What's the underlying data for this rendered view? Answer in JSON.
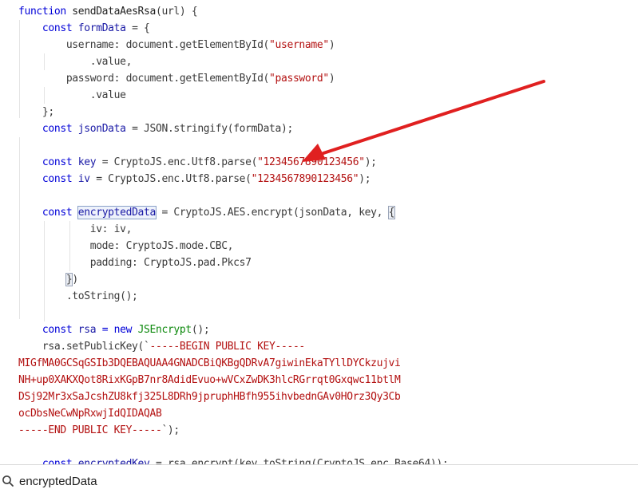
{
  "editor": {
    "lines": [
      [
        {
          "t": "function ",
          "c": "kw"
        },
        {
          "t": "sendDataAesRsa",
          "c": "fn"
        },
        {
          "t": "(url) {",
          "c": "id"
        }
      ],
      [
        {
          "t": "    const ",
          "c": "kw"
        },
        {
          "t": "formData",
          "c": "var"
        },
        {
          "t": " = {",
          "c": "id"
        }
      ],
      [
        {
          "t": "        username: document.getElementById(",
          "c": "id"
        },
        {
          "t": "\"username\"",
          "c": "str"
        },
        {
          "t": ")",
          "c": "id"
        }
      ],
      [
        {
          "t": "            .value,",
          "c": "id"
        }
      ],
      [
        {
          "t": "        password: document.getElementById(",
          "c": "id"
        },
        {
          "t": "\"password\"",
          "c": "str"
        },
        {
          "t": ")",
          "c": "id"
        }
      ],
      [
        {
          "t": "            .value",
          "c": "id"
        }
      ],
      [
        {
          "t": "    };",
          "c": "id"
        }
      ],
      [
        {
          "t": "    const ",
          "c": "kw"
        },
        {
          "t": "jsonData",
          "c": "var"
        },
        {
          "t": " = JSON.stringify(formData);",
          "c": "id"
        }
      ],
      [],
      [
        {
          "t": "    const ",
          "c": "kw"
        },
        {
          "t": "key",
          "c": "var"
        },
        {
          "t": " = CryptoJS.enc.Utf8.parse(",
          "c": "id"
        },
        {
          "t": "\"1234567890123456\"",
          "c": "str"
        },
        {
          "t": ");",
          "c": "id"
        }
      ],
      [
        {
          "t": "    const ",
          "c": "kw"
        },
        {
          "t": "iv",
          "c": "var"
        },
        {
          "t": " = CryptoJS.enc.Utf8.parse(",
          "c": "id"
        },
        {
          "t": "\"1234567890123456\"",
          "c": "str"
        },
        {
          "t": ");",
          "c": "id"
        }
      ],
      [],
      [
        {
          "t": "    const ",
          "c": "kw"
        },
        {
          "t": "encryptedData",
          "c": "var",
          "m": "bound"
        },
        {
          "t": " = CryptoJS.AES.encrypt(jsonData, key, ",
          "c": "id"
        },
        {
          "t": "{",
          "c": "id",
          "m": "brk"
        }
      ],
      [
        {
          "t": "            iv: iv,",
          "c": "id"
        }
      ],
      [
        {
          "t": "            mode: CryptoJS.mode.CBC,",
          "c": "id"
        }
      ],
      [
        {
          "t": "            padding: CryptoJS.pad.Pkcs7",
          "c": "id"
        }
      ],
      [
        {
          "t": "        ",
          "c": "id"
        },
        {
          "t": "}",
          "c": "id",
          "m": "brk"
        },
        {
          "t": ")",
          "c": "id"
        }
      ],
      [
        {
          "t": "        .toString();",
          "c": "id"
        }
      ],
      [],
      [
        {
          "t": "    const ",
          "c": "kw"
        },
        {
          "t": "rsa",
          "c": "var"
        },
        {
          "t": " = new ",
          "c": "kw"
        },
        {
          "t": "JSEncrypt",
          "c": "cls"
        },
        {
          "t": "();",
          "c": "id"
        }
      ],
      [
        {
          "t": "    rsa.setPublicKey(`",
          "c": "id"
        },
        {
          "t": "-----BEGIN PUBLIC KEY-----",
          "c": "str"
        }
      ],
      [
        {
          "t": "MIGfMA0GCSqGSIb3DQEBAQUAA4GNADCBiQKBgQDRvA7giwinEkaTYllDYCkzujvi",
          "c": "str"
        }
      ],
      [
        {
          "t": "NH+up0XAKXQot8RixKGpB7nr8AdidEvuo+wVCxZwDK3hlcRGrrqt0Gxqwc11btlM",
          "c": "str"
        }
      ],
      [
        {
          "t": "DSj92Mr3xSaJcshZU8kfj325L8DRh9jpruphHBfh955ihvbednGAv0HOrz3Qy3Cb",
          "c": "str"
        }
      ],
      [
        {
          "t": "ocDbsNeCwNpRxwjIdQIDAQAB",
          "c": "str"
        }
      ],
      [
        {
          "t": "-----END PUBLIC KEY-----",
          "c": "str"
        },
        {
          "t": "`);",
          "c": "id"
        }
      ],
      [],
      [
        {
          "t": "    const ",
          "c": "kw"
        },
        {
          "t": "encryptedKey",
          "c": "var"
        },
        {
          "t": " = rsa.encrypt(key.toString(CryptoJS.enc.Base64));",
          "c": "id"
        }
      ]
    ]
  },
  "search": {
    "icon": "search-icon",
    "value": "encryptedData"
  },
  "annotation": {
    "icon": "red-arrow-icon",
    "color": "#e02020"
  }
}
